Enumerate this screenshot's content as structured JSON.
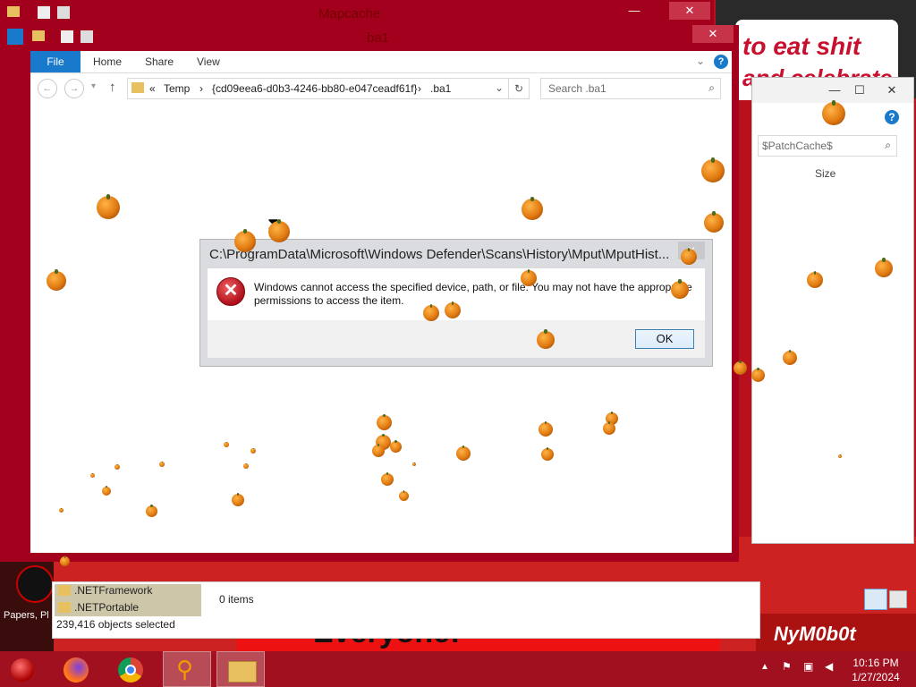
{
  "back_windows": {
    "top_title": "Mapcache",
    "second_title": "ba1",
    "right_search_text": "$PatchCache$",
    "size_header": "Size",
    "folders": [
      ".NETFramework",
      ".NETPortable"
    ],
    "items_count": "0 items",
    "objects_selected": "239,416 objects selected"
  },
  "wallpaper": {
    "sign_line1": "to eat shit",
    "sign_line2": "and celebrate",
    "banner": "Everyone!",
    "corner_text": "NyM0b0t",
    "desktop_icon_label": "Papers, Pl"
  },
  "explorer": {
    "tabs": [
      "File",
      "Home",
      "Share",
      "View"
    ],
    "nav": {
      "back": "←",
      "forward": "→",
      "recent": "▾",
      "up": "↑"
    },
    "breadcrumb": [
      "«",
      "Temp",
      "›",
      "{cd09eea6-d0b3-4246-bb80-e047ceadf61f}",
      "›",
      ".ba1"
    ],
    "search_placeholder": "Search .ba1"
  },
  "dialog": {
    "title": "C:\\ProgramData\\Microsoft\\Windows Defender\\Scans\\History\\Mput\\MputHist...",
    "message": "Windows cannot access the specified device, path, or file. You may not have the appropriate permissions to access the item.",
    "ok_label": "OK",
    "close_glyph": "✕",
    "error_glyph": "✕"
  },
  "taskbar": {
    "apps": [
      "start-orb",
      "firefox",
      "chrome",
      "search-magnifier",
      "file-explorer"
    ],
    "time": "10:16 PM",
    "date": "1/27/2024",
    "tray_arrow": "▲"
  },
  "titlebar": {
    "minimize": "—",
    "maximize": "☐",
    "close": "✕",
    "help": "?"
  }
}
